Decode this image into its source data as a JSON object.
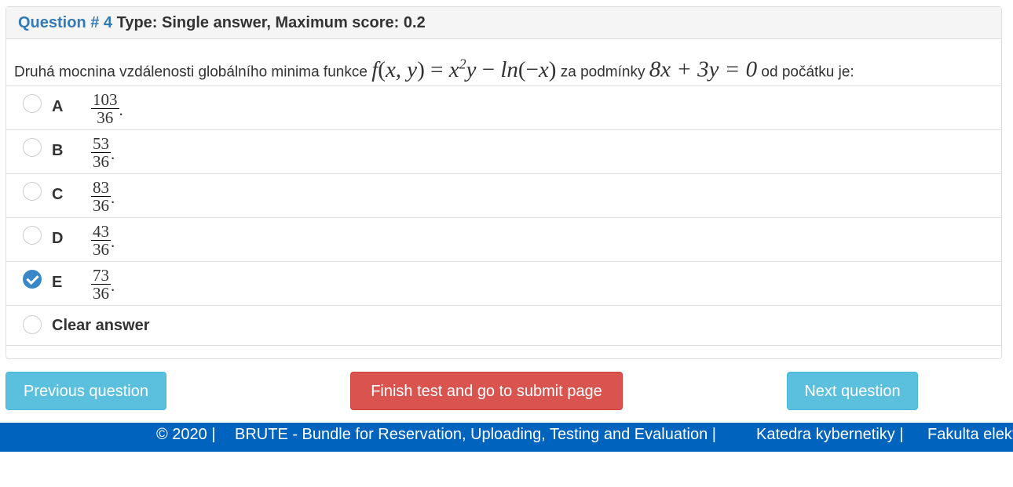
{
  "header": {
    "question_number": "Question # 4",
    "type_info": "Type: Single answer, Maximum score: 0.2"
  },
  "question": {
    "text_before": "Druhá mocnina vzdálenosti globálního minima funkce",
    "formula": "f(x, y) = x²y − ln(−x)",
    "text_middle": "za podmínky",
    "constraint": "8x + 3y = 0",
    "text_after": "od počátku je:"
  },
  "options": [
    {
      "label": "A",
      "numerator": "103",
      "denominator": "36",
      "selected": false
    },
    {
      "label": "B",
      "numerator": "53",
      "denominator": "36",
      "selected": false
    },
    {
      "label": "C",
      "numerator": "83",
      "denominator": "36",
      "selected": false
    },
    {
      "label": "D",
      "numerator": "43",
      "denominator": "36",
      "selected": false
    },
    {
      "label": "E",
      "numerator": "73",
      "denominator": "36",
      "selected": true
    }
  ],
  "clear_answer": "Clear answer",
  "buttons": {
    "previous": "Previous question",
    "finish": "Finish test and go to submit page",
    "next": "Next question"
  },
  "footer": {
    "copyright": "© 2020 |",
    "brute": "BRUTE - Bundle for Reservation, Uploading, Testing and Evaluation |",
    "katedra": "Katedra kybernetiky |",
    "fakulta": "Fakulta elektrotechnická"
  },
  "colors": {
    "accent": "#337ab7",
    "info": "#5bc0de",
    "danger": "#d9534f",
    "footer": "#0063be"
  }
}
